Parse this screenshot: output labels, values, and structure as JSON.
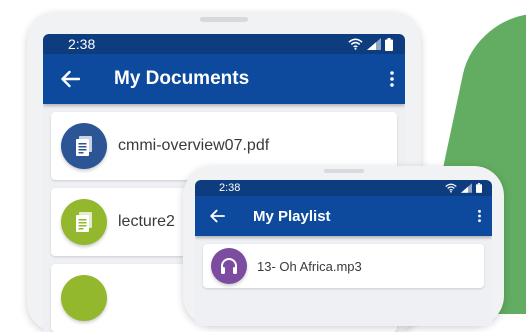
{
  "colors": {
    "statusbar": "#0d3d7f",
    "appbar": "#0d4a9e",
    "pdf_icon_bg": "#2c5595",
    "doc_icon_bg": "#93b82d",
    "music_icon_bg": "#7b4ca0",
    "background_shape": "#62ad61"
  },
  "documents_phone": {
    "status_time": "2:38",
    "title": "My Documents",
    "back_icon": "arrow-left-icon",
    "menu_icon": "more-vert-icon",
    "files": [
      {
        "name": "cmmi-overview07.pdf",
        "icon": "pdf-file-icon"
      },
      {
        "name": "lecture2",
        "icon": "doc-file-icon"
      },
      {
        "name": "",
        "icon": "doc-file-icon"
      }
    ]
  },
  "playlist_phone": {
    "status_time": "2:38",
    "title": "My Playlist",
    "back_icon": "arrow-left-icon",
    "menu_icon": "more-vert-icon",
    "tracks": [
      {
        "name": "13- Oh Africa.mp3",
        "icon": "headphones-icon"
      }
    ]
  }
}
